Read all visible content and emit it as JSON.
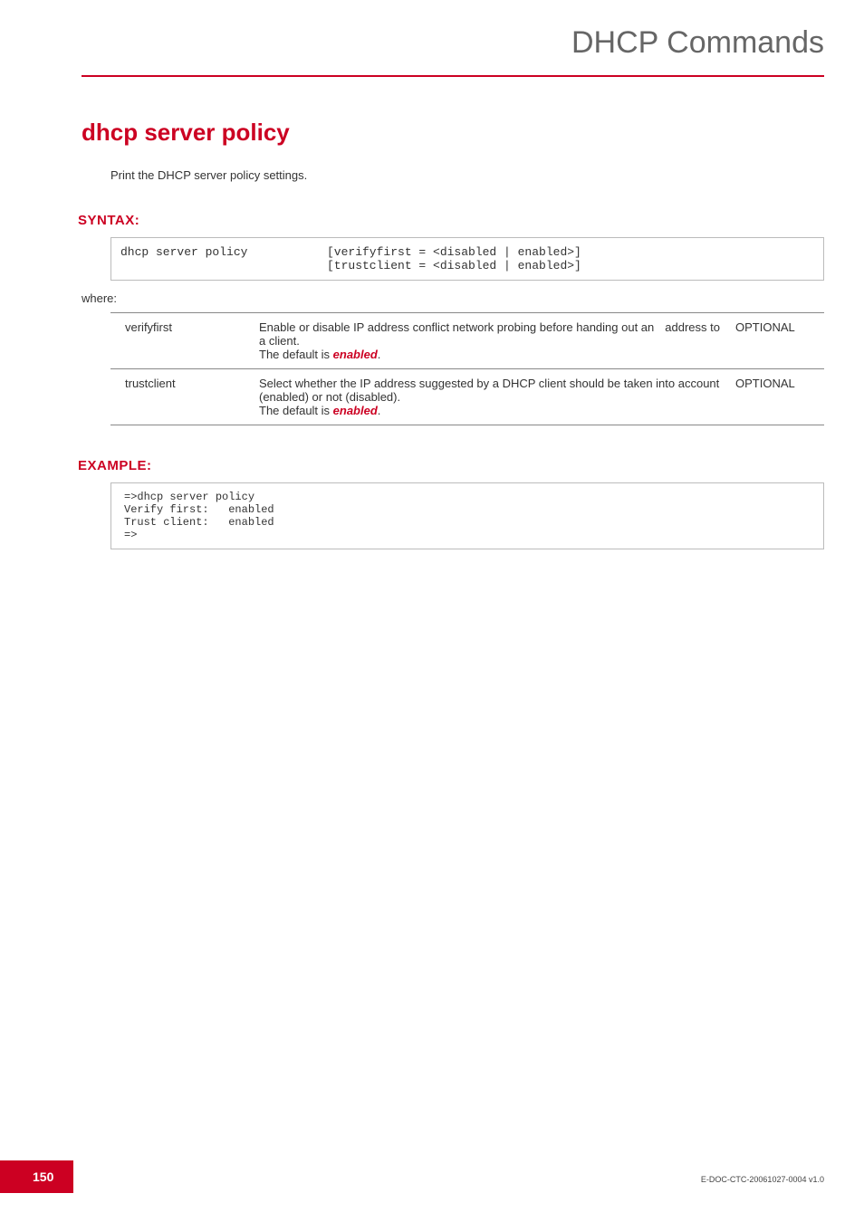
{
  "header": {
    "title": "DHCP Commands"
  },
  "command": {
    "title": "dhcp server policy",
    "description": "Print the DHCP server policy settings."
  },
  "syntax": {
    "label": "SYNTAX:",
    "command": "dhcp server policy",
    "args": "[verifyfirst = <disabled | enabled>]\n[trustclient = <disabled | enabled>]"
  },
  "where_label": "where:",
  "params": [
    {
      "name": "verifyfirst",
      "desc_pre": "Enable or disable IP address conflict network probing before handing out an",
      "desc_mid": "address to a client.",
      "default_line": "The default is ",
      "default_value": "enabled",
      "default_after": ".",
      "req": "OPTIONAL"
    },
    {
      "name": "trustclient",
      "desc_pre": "Select whether the IP address suggested by a DHCP client should be taken into account (enabled) or not (disabled).",
      "desc_mid": "",
      "default_line": "The default is ",
      "default_value": "enabled",
      "default_after": ".",
      "req": "OPTIONAL"
    }
  ],
  "example": {
    "label": "EXAMPLE:",
    "body": "=>dhcp server policy\nVerify first:   enabled\nTrust client:   enabled\n=>"
  },
  "footer": {
    "page": "150",
    "docref": "E-DOC-CTC-20061027-0004 v1.0"
  }
}
